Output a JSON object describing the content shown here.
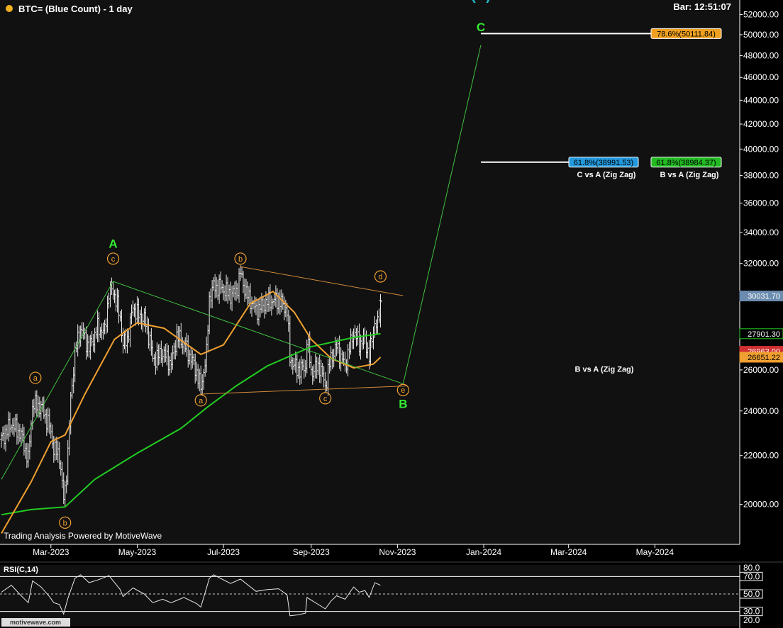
{
  "header": {
    "symbol_label": "BTC= (Blue Count) - 1 day",
    "bar_time": "Bar: 12:51:07"
  },
  "watermark": "Trading Analysis Powered by MotiveWave",
  "footer_logo": "motivewave.com",
  "colors": {
    "background": "#111111",
    "price_bars": "#e8e8e8",
    "ma_slow": "#22cc22",
    "ma_fast": "#f0a030",
    "wave_green": "#33ee33",
    "wave_teal": "#22bbcc",
    "channel": "#d08a3a",
    "zigzag": "#40c040",
    "projection": "#40c040"
  },
  "chart_data": {
    "type": "candlestick",
    "title": "BTC= (Blue Count) - 1 day",
    "y_axis": {
      "ticks": [
        20000,
        22000,
        24000,
        26000,
        28000,
        30000,
        32000,
        34000,
        36000,
        38000,
        40000,
        42000,
        44000,
        46000,
        48000,
        50000,
        52000
      ],
      "tick_labels": [
        "20000.00",
        "22000.00",
        "24000.00",
        "26000.00",
        "28000.00",
        "30000.00",
        "32000.00",
        "34000.00",
        "36000.00",
        "38000.00",
        "40000.00",
        "42000.00",
        "44000.00",
        "46000.00",
        "48000.00",
        "50000.00",
        "52000.00"
      ],
      "scale": "log",
      "range": [
        18500,
        53500
      ]
    },
    "x_axis": {
      "ticks": [
        "2023-03-01",
        "2023-05-01",
        "2023-07-01",
        "2023-09-01",
        "2023-11-01",
        "2024-01-01",
        "2024-03-01",
        "2024-05-01"
      ],
      "tick_labels": [
        "Mar-2023",
        "May-2023",
        "Jul-2023",
        "Sep-2023",
        "Nov-2023",
        "Jan-2024",
        "Mar-2024",
        "May-2024"
      ],
      "range": [
        "2023-01-24",
        "2024-06-30"
      ]
    },
    "price_series": [
      [
        "2023-01-25",
        22700
      ],
      [
        "2023-02-01",
        23400
      ],
      [
        "2023-02-08",
        22900
      ],
      [
        "2023-02-13",
        21800
      ],
      [
        "2023-02-16",
        24300
      ],
      [
        "2023-02-22",
        24200
      ],
      [
        "2023-02-28",
        23300
      ],
      [
        "2023-03-03",
        22300
      ],
      [
        "2023-03-07",
        22000
      ],
      [
        "2023-03-10",
        20200
      ],
      [
        "2023-03-11",
        20600
      ],
      [
        "2023-03-13",
        22100
      ],
      [
        "2023-03-15",
        24500
      ],
      [
        "2023-03-18",
        26900
      ],
      [
        "2023-03-22",
        28200
      ],
      [
        "2023-03-28",
        27100
      ],
      [
        "2023-04-03",
        28200
      ],
      [
        "2023-04-08",
        28000
      ],
      [
        "2023-04-11",
        30200
      ],
      [
        "2023-04-14",
        30400
      ],
      [
        "2023-04-19",
        28800
      ],
      [
        "2023-04-21",
        27300
      ],
      [
        "2023-04-24",
        27600
      ],
      [
        "2023-04-28",
        29400
      ],
      [
        "2023-05-03",
        28800
      ],
      [
        "2023-05-06",
        28700
      ],
      [
        "2023-05-10",
        27600
      ],
      [
        "2023-05-12",
        26500
      ],
      [
        "2023-05-19",
        26900
      ],
      [
        "2023-05-25",
        26300
      ],
      [
        "2023-05-29",
        27800
      ],
      [
        "2023-06-03",
        27300
      ],
      [
        "2023-06-08",
        26600
      ],
      [
        "2023-06-12",
        25900
      ],
      [
        "2023-06-15",
        25100
      ],
      [
        "2023-06-19",
        26800
      ],
      [
        "2023-06-21",
        29900
      ],
      [
        "2023-06-24",
        30600
      ],
      [
        "2023-06-30",
        30500
      ],
      [
        "2023-07-06",
        30100
      ],
      [
        "2023-07-10",
        30300
      ],
      [
        "2023-07-13",
        31400
      ],
      [
        "2023-07-17",
        30200
      ],
      [
        "2023-07-24",
        29200
      ],
      [
        "2023-08-01",
        29700
      ],
      [
        "2023-08-09",
        29800
      ],
      [
        "2023-08-15",
        29200
      ],
      [
        "2023-08-17",
        26600
      ],
      [
        "2023-08-22",
        26000
      ],
      [
        "2023-08-28",
        26100
      ],
      [
        "2023-08-29",
        27700
      ],
      [
        "2023-09-01",
        25900
      ],
      [
        "2023-09-07",
        26200
      ],
      [
        "2023-09-11",
        25200
      ],
      [
        "2023-09-15",
        26600
      ],
      [
        "2023-09-19",
        27200
      ],
      [
        "2023-09-25",
        26200
      ],
      [
        "2023-10-01",
        28000
      ],
      [
        "2023-10-05",
        27400
      ],
      [
        "2023-10-09",
        27600
      ],
      [
        "2023-10-12",
        26700
      ],
      [
        "2023-10-16",
        28500
      ],
      [
        "2023-10-18",
        28300
      ],
      [
        "2023-10-20",
        29700
      ],
      [
        "2023-10-20",
        30031.7
      ]
    ],
    "moving_averages": [
      {
        "name": "slow",
        "color": "#22cc22",
        "points": [
          [
            "2023-01-25",
            19600
          ],
          [
            "2023-02-15",
            19800
          ],
          [
            "2023-03-11",
            19900
          ],
          [
            "2023-04-01",
            21000
          ],
          [
            "2023-05-01",
            22100
          ],
          [
            "2023-06-01",
            23200
          ],
          [
            "2023-06-20",
            24200
          ],
          [
            "2023-07-10",
            25200
          ],
          [
            "2023-08-01",
            26200
          ],
          [
            "2023-09-01",
            27200
          ],
          [
            "2023-10-01",
            27700
          ],
          [
            "2023-10-20",
            27901.3
          ]
        ]
      },
      {
        "name": "fast",
        "color": "#f0a030",
        "points": [
          [
            "2023-01-25",
            18900
          ],
          [
            "2023-02-15",
            20900
          ],
          [
            "2023-03-01",
            22600
          ],
          [
            "2023-03-11",
            22900
          ],
          [
            "2023-03-25",
            24800
          ],
          [
            "2023-04-15",
            27600
          ],
          [
            "2023-05-01",
            28500
          ],
          [
            "2023-05-20",
            28200
          ],
          [
            "2023-06-15",
            26800
          ],
          [
            "2023-07-01",
            27300
          ],
          [
            "2023-07-20",
            29600
          ],
          [
            "2023-08-05",
            30300
          ],
          [
            "2023-08-20",
            29100
          ],
          [
            "2023-09-01",
            27600
          ],
          [
            "2023-09-15",
            26600
          ],
          [
            "2023-10-01",
            26100
          ],
          [
            "2023-10-15",
            26300
          ],
          [
            "2023-10-20",
            26651.22
          ]
        ]
      }
    ],
    "price_tags": [
      {
        "value": 30031.7,
        "label": "30031.70",
        "bg": "#6b8cae",
        "fg": "#ffffff"
      },
      {
        "value": 27901.3,
        "label": "27901.30",
        "bg": "#000000",
        "fg": "#ffffff",
        "border": "#22cc22"
      },
      {
        "value": 26963.0,
        "label": "26963.00",
        "bg": "#d03030",
        "fg": "#ffffff"
      },
      {
        "value": 26651.22,
        "label": "26651.22",
        "bg": "#f0a030",
        "fg": "#000000"
      }
    ],
    "wave_labels": [
      {
        "text": "A",
        "date": "2023-04-14",
        "price": 33000,
        "color": "#33ee33",
        "size": 17
      },
      {
        "text": "B",
        "date": "2023-11-05",
        "price": 24150,
        "color": "#33ee33",
        "size": 17
      },
      {
        "text": "C",
        "date": "2023-12-30",
        "price": 50350,
        "color": "#33ee33",
        "size": 17
      },
      {
        "text": "(B)",
        "date": "2023-12-30",
        "price": 53500,
        "color": "#22bbcc",
        "size": 20
      }
    ],
    "circle_labels": [
      {
        "text": "a",
        "date": "2023-02-18",
        "price": 25600
      },
      {
        "text": "c",
        "date": "2023-04-14",
        "price": 32300
      },
      {
        "text": "b",
        "date": "2023-03-11",
        "price": 19300
      },
      {
        "text": "b",
        "date": "2023-07-13",
        "price": 32300
      },
      {
        "text": "a",
        "date": "2023-06-15",
        "price": 24500
      },
      {
        "text": "c",
        "date": "2023-09-11",
        "price": 24600
      },
      {
        "text": "d",
        "date": "2023-10-20",
        "price": 31200
      },
      {
        "text": "e",
        "date": "2023-11-05",
        "price": 25000
      }
    ],
    "fib_levels": [
      {
        "ratio": "78.6%",
        "value": "50111.84",
        "label": "78.6%(50111.84)",
        "price": 50111.84,
        "bg": "#f0a020",
        "fg": "#000000",
        "line_from": "2023-12-30"
      },
      {
        "ratio": "61.8%",
        "value": "38991.53",
        "label": "61.8%(38991.53)",
        "price": 38991.53,
        "bg": "#2299dd",
        "fg": "#000000",
        "line_from": "2023-12-30",
        "caption": "C vs A (Zig Zag)"
      },
      {
        "ratio": "61.8%",
        "value": "38984.37",
        "label": "61.8%(38984.37)",
        "price": 38984.37,
        "bg": "#22bb22",
        "fg": "#000000",
        "caption": "B vs A (Zig Zag)"
      }
    ],
    "floating_caption": "B vs A (Zig Zag)",
    "rsi": {
      "label": "RSI(C,14)",
      "ticks": [
        "80.0",
        "70.0",
        "50.0",
        "30.0",
        "20.0"
      ],
      "levels": [
        80,
        70,
        50,
        30,
        20
      ],
      "range": [
        20,
        80
      ],
      "points": [
        [
          "2023-01-25",
          52
        ],
        [
          "2023-02-01",
          60
        ],
        [
          "2023-02-08",
          48
        ],
        [
          "2023-02-13",
          40
        ],
        [
          "2023-02-16",
          65
        ],
        [
          "2023-02-22",
          58
        ],
        [
          "2023-02-28",
          47
        ],
        [
          "2023-03-03",
          40
        ],
        [
          "2023-03-07",
          38
        ],
        [
          "2023-03-10",
          27
        ],
        [
          "2023-03-13",
          45
        ],
        [
          "2023-03-18",
          68
        ],
        [
          "2023-03-22",
          72
        ],
        [
          "2023-03-28",
          63
        ],
        [
          "2023-04-03",
          66
        ],
        [
          "2023-04-11",
          71
        ],
        [
          "2023-04-19",
          55
        ],
        [
          "2023-04-21",
          47
        ],
        [
          "2023-04-28",
          57
        ],
        [
          "2023-05-06",
          50
        ],
        [
          "2023-05-12",
          40
        ],
        [
          "2023-05-19",
          44
        ],
        [
          "2023-05-25",
          40
        ],
        [
          "2023-06-03",
          46
        ],
        [
          "2023-06-12",
          39
        ],
        [
          "2023-06-15",
          35
        ],
        [
          "2023-06-21",
          68
        ],
        [
          "2023-06-24",
          72
        ],
        [
          "2023-07-06",
          62
        ],
        [
          "2023-07-13",
          67
        ],
        [
          "2023-07-24",
          53
        ],
        [
          "2023-08-01",
          55
        ],
        [
          "2023-08-09",
          56
        ],
        [
          "2023-08-15",
          49
        ],
        [
          "2023-08-17",
          25
        ],
        [
          "2023-08-22",
          26
        ],
        [
          "2023-08-28",
          28
        ],
        [
          "2023-08-29",
          46
        ],
        [
          "2023-09-07",
          37
        ],
        [
          "2023-09-11",
          33
        ],
        [
          "2023-09-15",
          42
        ],
        [
          "2023-09-19",
          48
        ],
        [
          "2023-09-25",
          44
        ],
        [
          "2023-10-01",
          58
        ],
        [
          "2023-10-05",
          52
        ],
        [
          "2023-10-09",
          54
        ],
        [
          "2023-10-12",
          46
        ],
        [
          "2023-10-16",
          63
        ],
        [
          "2023-10-20",
          60
        ]
      ]
    },
    "zigzag": [
      [
        "2023-01-25",
        21000
      ],
      [
        "2023-04-14",
        30900
      ],
      [
        "2023-11-05",
        25300
      ],
      [
        "2023-12-30",
        49000
      ]
    ],
    "channel_lines": [
      [
        [
          "2023-07-13",
          31800
        ],
        [
          "2023-11-05",
          30050
        ]
      ],
      [
        [
          "2023-06-15",
          24800
        ],
        [
          "2023-11-08",
          25200
        ]
      ]
    ]
  }
}
